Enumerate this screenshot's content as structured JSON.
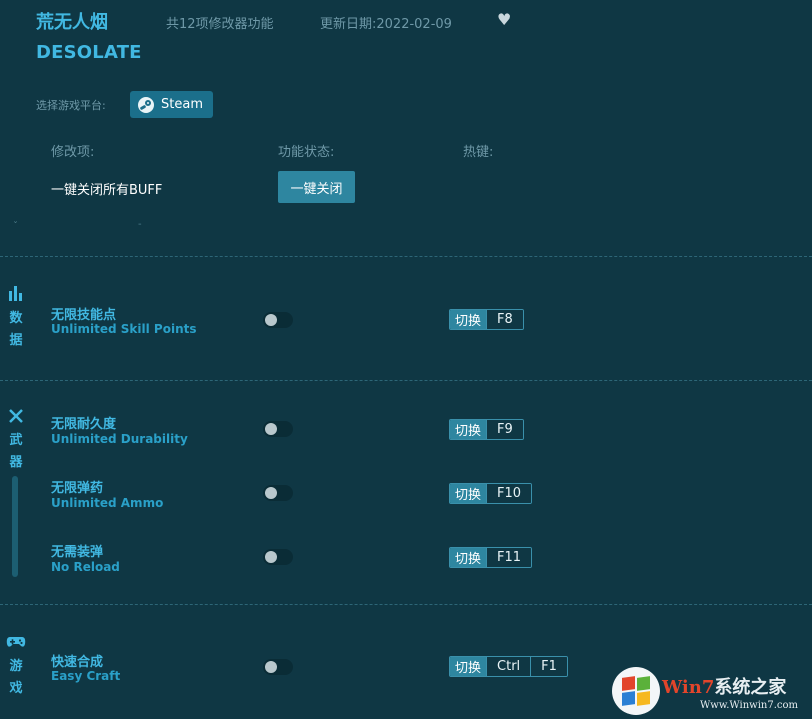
{
  "header": {
    "title_cn": "荒无人烟",
    "feature_count": "共12项修改器功能",
    "update_date": "更新日期:2022-02-09",
    "title_en": "DESOLATE"
  },
  "platform": {
    "label": "选择游戏平台:",
    "steam": "Steam"
  },
  "columns": {
    "item": "修改项:",
    "status": "功能状态:",
    "hotkey": "热键:"
  },
  "buff": {
    "label": "一键关闭所有BUFF",
    "button": "一键关闭"
  },
  "categories": {
    "data": "数\n据",
    "weapon": "武\n器",
    "game": "游\n戏"
  },
  "items": [
    {
      "cn": "无限技能点",
      "en": "Unlimited Skill Points",
      "switch": "切换",
      "keys": [
        "F8"
      ]
    },
    {
      "cn": "无限耐久度",
      "en": "Unlimited Durability",
      "switch": "切换",
      "keys": [
        "F9"
      ]
    },
    {
      "cn": "无限弹药",
      "en": "Unlimited Ammo",
      "switch": "切换",
      "keys": [
        "F10"
      ]
    },
    {
      "cn": "无需装弹",
      "en": "No Reload",
      "switch": "切换",
      "keys": [
        "F11"
      ]
    },
    {
      "cn": "快速合成",
      "en": "Easy Craft",
      "switch": "切换",
      "keys": [
        "Ctrl",
        "F1"
      ]
    }
  ],
  "watermark": {
    "brand_a": "Win7",
    "brand_b": "系统之家",
    "url": "Www.Winwin7.com"
  },
  "colors": {
    "background": "#0f3744",
    "accent": "#41b8e2",
    "button": "#2e86a0"
  }
}
